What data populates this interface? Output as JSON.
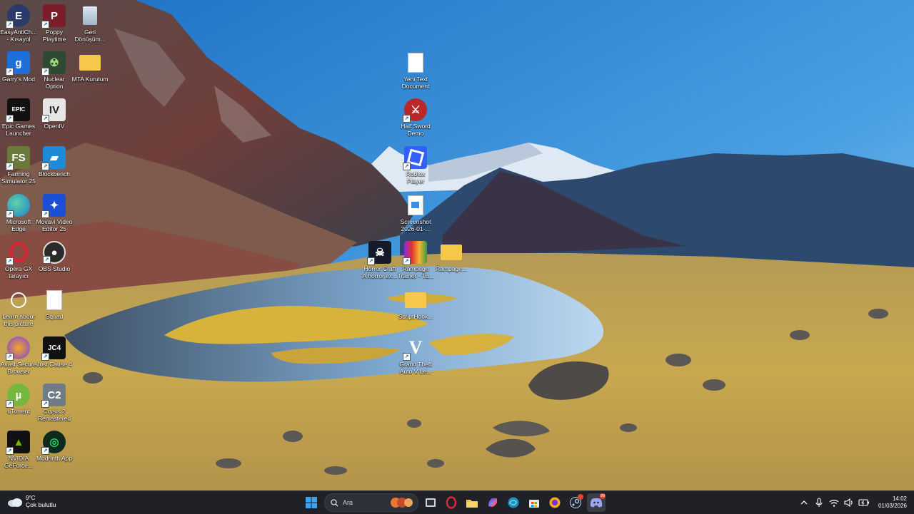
{
  "desktop": {
    "icons": [
      {
        "label": "EasyAntiCh... - Kısayol"
      },
      {
        "label": "Poppy Playtime"
      },
      {
        "label": "Geri Dönüşüm..."
      },
      {
        "label": "Garry's Mod"
      },
      {
        "label": "Nuclear Option"
      },
      {
        "label": "MTA Kurulum"
      },
      {
        "label": "Epic Games Launcher"
      },
      {
        "label": "OpenIV"
      },
      {
        "label": "Farming Simulator 25"
      },
      {
        "label": "Blockbench"
      },
      {
        "label": "Microsoft Edge"
      },
      {
        "label": "Movavi Video Editor 25"
      },
      {
        "label": "Opera GX tarayıcı"
      },
      {
        "label": "OBS Studio"
      },
      {
        "label": "Learn about this picture"
      },
      {
        "label": "Squad"
      },
      {
        "label": "Avast Secure Browser"
      },
      {
        "label": "Just Cause 4"
      },
      {
        "label": "uTorrent"
      },
      {
        "label": "Crysis 2 Remastered"
      },
      {
        "label": "NVIDIA GeForce..."
      },
      {
        "label": "Modrinth App"
      },
      {
        "label": "Yeni Text Document"
      },
      {
        "label": "Half Sword Demo"
      },
      {
        "label": "Roblox Player"
      },
      {
        "label": "Screenshot 2026-01-..."
      },
      {
        "label": "Horror Craft A horror ex..."
      },
      {
        "label": "Rampage Trainer - Tu..."
      },
      {
        "label": "Rampage..."
      },
      {
        "label": "ScriptHook..."
      },
      {
        "label": "Grand Theft Auto V Le..."
      }
    ]
  },
  "taskbar": {
    "weather_temp": "9°C",
    "weather_desc": "Çok bulutlu",
    "search_placeholder": "Ara",
    "notification_count": "99",
    "time": "14:02",
    "date": "01/03/2026"
  },
  "colors": {
    "taskbar_bg": "#1f2126",
    "accent": "#0078d4"
  }
}
